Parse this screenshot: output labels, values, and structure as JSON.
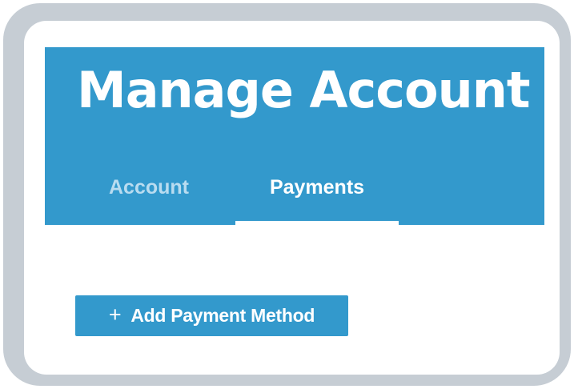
{
  "page": {
    "title": "Manage Account"
  },
  "tabs": [
    {
      "label": "Account",
      "active": false
    },
    {
      "label": "Payments",
      "active": true
    }
  ],
  "actions": {
    "add_payment_icon": "+",
    "add_payment_label": "Add Payment Method"
  },
  "colors": {
    "header_background": "#3399cc",
    "frame_border": "#c6cdd4",
    "button_background": "#3399cc",
    "active_tab_text": "#ffffff",
    "inactive_tab_text": "#b9dcf0"
  }
}
